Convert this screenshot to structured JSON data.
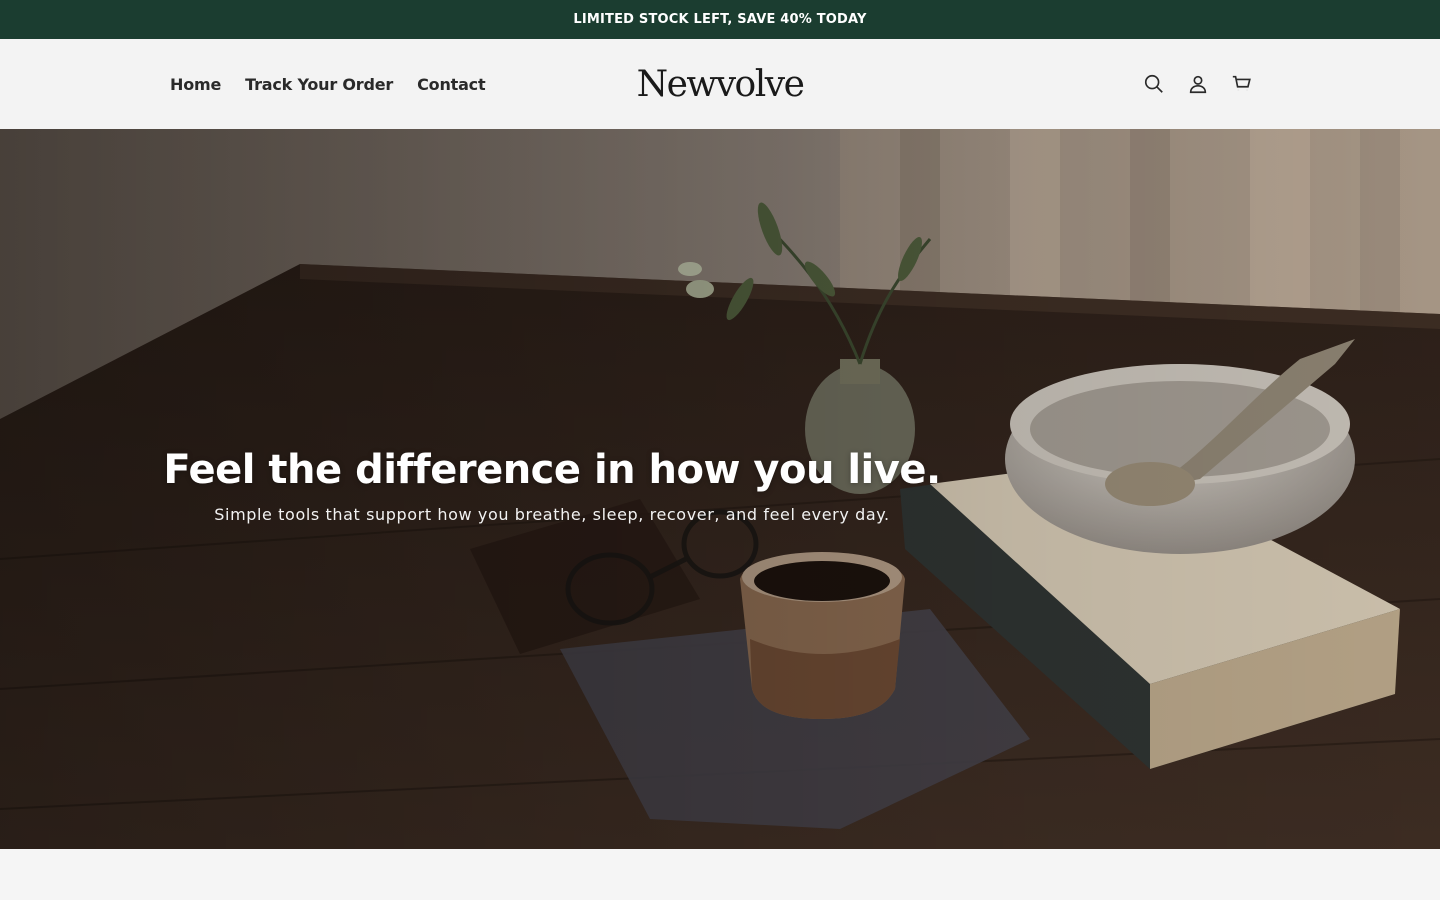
{
  "announcement": {
    "text": "LIMITED STOCK LEFT, SAVE 40% TODAY"
  },
  "header": {
    "nav": [
      {
        "label": "Home"
      },
      {
        "label": "Track Your Order"
      },
      {
        "label": "Contact"
      }
    ],
    "logo": "Newvolve",
    "icons": [
      "search-icon",
      "account-icon",
      "cart-icon"
    ]
  },
  "hero": {
    "title": "Feel the difference in how you live.",
    "subtitle": "Simple tools that support how you breathe, sleep, recover, and feel every day."
  },
  "colors": {
    "announcement_bg": "#1b3d30",
    "header_bg": "#f3f3f3",
    "text": "#1e1e1e"
  }
}
